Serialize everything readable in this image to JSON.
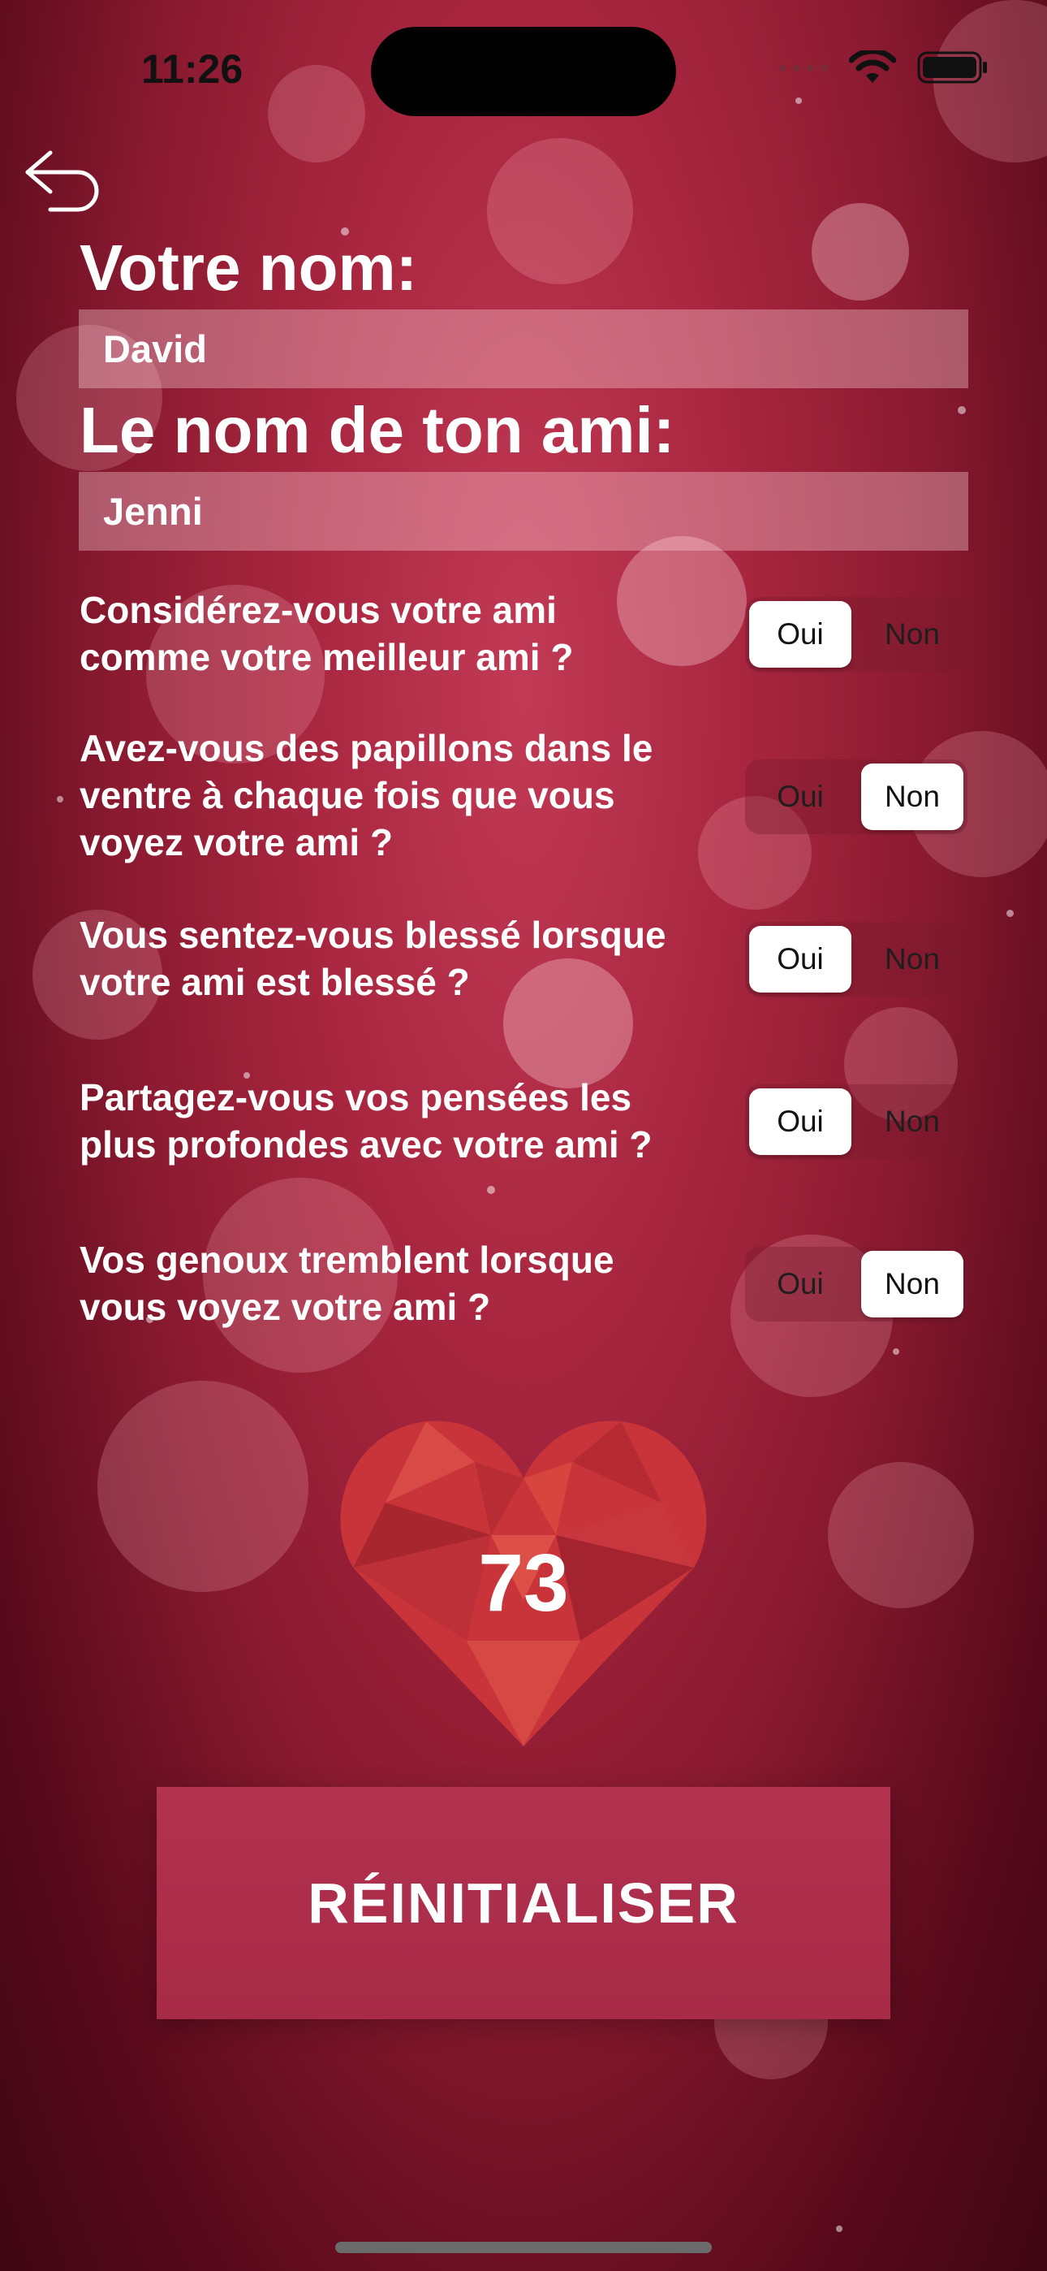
{
  "status_bar": {
    "time": "11:26"
  },
  "form": {
    "your_name_label": "Votre nom:",
    "your_name_value": "David",
    "friend_name_label": "Le nom de ton ami:",
    "friend_name_value": "Jenni"
  },
  "questions": [
    {
      "text_line1": "Considérez-vous votre ami",
      "text_line2": "comme votre meilleur ami ?",
      "text_line3": "",
      "yes": "Oui",
      "no": "Non",
      "selected": "Oui"
    },
    {
      "text_line1": "Avez-vous des papillons dans le",
      "text_line2": "ventre à chaque fois que vous",
      "text_line3": "voyez votre ami ?",
      "yes": "Oui",
      "no": "Non",
      "selected": "Non"
    },
    {
      "text_line1": "Vous sentez-vous blessé lorsque",
      "text_line2": "votre ami est blessé ?",
      "text_line3": "",
      "yes": "Oui",
      "no": "Non",
      "selected": "Oui"
    },
    {
      "text_line1": "Partagez-vous vos pensées les",
      "text_line2": "plus profondes avec votre ami ?",
      "text_line3": "",
      "yes": "Oui",
      "no": "Non",
      "selected": "Oui"
    },
    {
      "text_line1": "Vos genoux tremblent lorsque",
      "text_line2": "vous voyez votre ami ?",
      "text_line3": "",
      "yes": "Oui",
      "no": "Non",
      "selected": "Non"
    }
  ],
  "result": {
    "score": "73"
  },
  "reset_button": {
    "label": "RÉINITIALISER"
  },
  "icons": {
    "back": "undo-arrow-icon",
    "heart": "low-poly-heart-icon",
    "wifi": "wifi-icon",
    "battery": "battery-icon"
  },
  "colors": {
    "background": "#a8263f",
    "button": "#b2324f",
    "heart": "#d03a3a"
  }
}
